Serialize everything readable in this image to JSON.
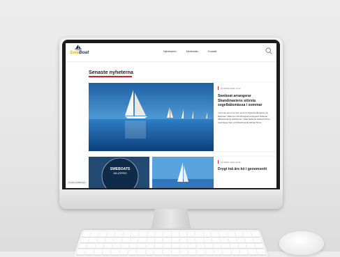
{
  "site": {
    "logo": {
      "swe": "Swe",
      "boat": "Boat"
    },
    "nav": [
      "Nyhetsarkiv",
      "Mediearkiv",
      "Kontakt"
    ],
    "section_heading": "Senaste nyheterna"
  },
  "feature": {
    "date": "29 MARS 2022 10:12",
    "title": "Sweboat arrangerar Skandinaviens största segelbåtsmässa i sommar",
    "body": "I sommar kan ni se fram emot tre flytande båtmässor på Marinaen. Målet den 26-28 augusti arrangerar Sweboat - båtbranschens riksförbund - både Sweboat Sailboat Show med Öppet Varv och Motorboat Motorboat Show."
  },
  "second_card": {
    "date": "19 APRIL 2021 13:49",
    "title": "Drygt två års kö i genomsnitt"
  },
  "thumb_badge": {
    "line1": "SWEBOATS",
    "line2": "MILJÖPRIS"
  },
  "cookie_label": "Cookie-inställningar",
  "colors": {
    "accent": "#c8222e",
    "brand_yellow": "#e7b416",
    "brand_navy": "#1d2c55"
  },
  "icons": {
    "logo": "sailboat-logo-icon",
    "search": "search-icon"
  }
}
